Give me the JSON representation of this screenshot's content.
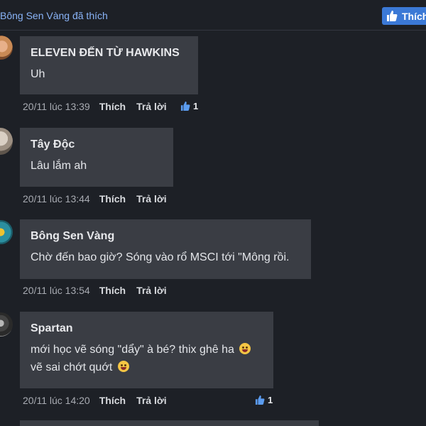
{
  "header": {
    "liked_by": "Bông Sen Vàng đã thích",
    "like_button_label": "Thích"
  },
  "comments": [
    {
      "author": "ELEVEN ĐẾN TỪ HAWKINS",
      "lines": [
        "Uh"
      ],
      "time": "20/11 lúc 13:39",
      "like_label": "Thích",
      "reply_label": "Trả lời",
      "likes": "1"
    },
    {
      "author": "Tây Độc",
      "lines": [
        "Lâu lắm ah"
      ],
      "time": "20/11 lúc 13:44",
      "like_label": "Thích",
      "reply_label": "Trả lời"
    },
    {
      "author": "Bông Sen Vàng",
      "lines": [
        "Chờ đến bao giờ? Sóng vào rổ MSCI tới \"Mông rồi."
      ],
      "time": "20/11 lúc 13:54",
      "like_label": "Thích",
      "reply_label": "Trả lời"
    },
    {
      "author": "Spartan",
      "lines": [
        "mới học vẽ sóng \"dẩy\" à bé? thix ghê ha",
        "vẽ sai chớt quớt"
      ],
      "time": "20/11 lúc 14:20",
      "like_label": "Thích",
      "reply_label": "Trả lời",
      "likes": "1"
    }
  ],
  "icons": {
    "like": "thumbs-up-icon",
    "emoji_laugh": "rofl-emoji-icon",
    "emoji_grin": "grin-emoji-icon"
  },
  "colors": {
    "background": "#1d2026",
    "bubble": "#3a3d44",
    "link": "#8ab4f8",
    "like_button": "#3b79d6"
  }
}
